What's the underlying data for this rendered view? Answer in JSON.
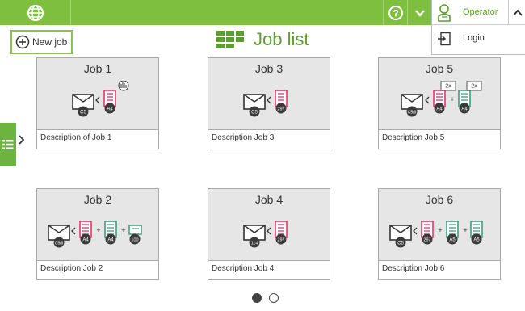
{
  "header": {
    "operator_label": "Operator",
    "login_label": "Login"
  },
  "toolbar": {
    "new_job_label": "New job"
  },
  "page": {
    "title": "Job list"
  },
  "jobs": [
    {
      "name": "Job 1",
      "description": "Description of Job 1",
      "envelope": "C5",
      "docs": [
        "A4"
      ]
    },
    {
      "name": "Job 3",
      "description": "Description Job 3",
      "envelope": "C5",
      "docs": [
        "297"
      ]
    },
    {
      "name": "Job 5",
      "description": "Description Job 5",
      "envelope": "C5/6",
      "docs": [
        "A4",
        "A4"
      ],
      "multipliers": [
        "2x",
        "2x"
      ]
    },
    {
      "name": "Job 2",
      "description": "Description Job 2",
      "envelope": "C5/6",
      "docs": [
        "A4",
        "A4",
        "100"
      ]
    },
    {
      "name": "Job 4",
      "description": "Description Job 4",
      "envelope": "114",
      "docs": [
        "297"
      ]
    },
    {
      "name": "Job 6",
      "description": "Description Job 6",
      "envelope": "C5",
      "docs": [
        "297",
        "A5",
        "A5"
      ]
    }
  ],
  "pagination": {
    "pages": 2,
    "current": 1
  },
  "colors": {
    "accent": "#7fbf3f",
    "pink": "#e8336b",
    "teal": "#3aa17e",
    "badge": "#3a3a3a"
  }
}
